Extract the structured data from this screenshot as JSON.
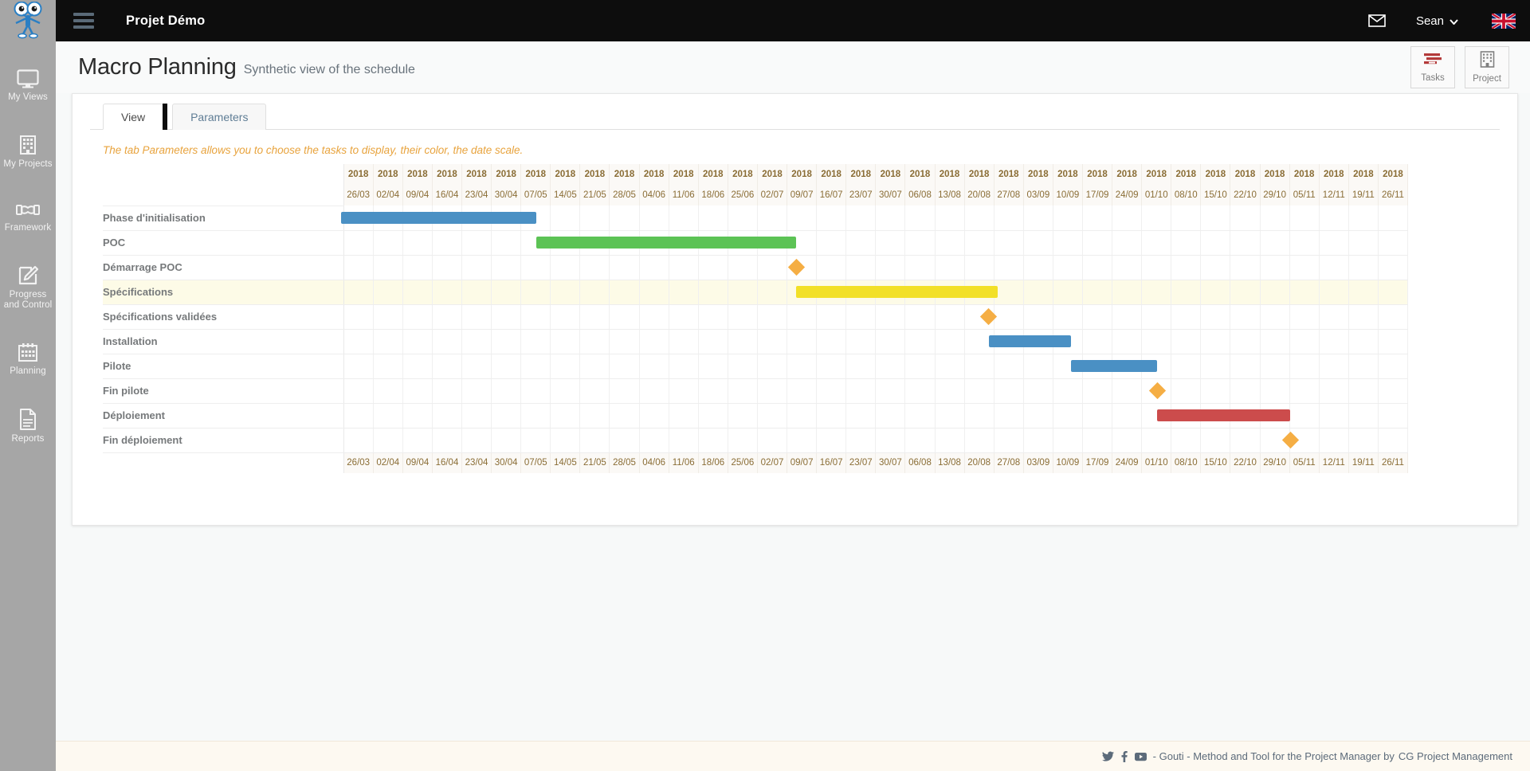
{
  "brand": {
    "logo_name": "gouti-mascot-logo"
  },
  "topbar": {
    "app_title": "Projet Démo",
    "menu_icon": "hamburger-menu-icon",
    "mail_icon": "envelope-icon",
    "user_name": "Sean",
    "chevron": "▾",
    "flag_icon": "uk-flag-icon"
  },
  "sidebar": {
    "items": [
      {
        "label": "My Views",
        "icon": "monitor-icon"
      },
      {
        "label": "My Projects",
        "icon": "building-icon"
      },
      {
        "label": "Framework",
        "icon": "handshake-icon"
      },
      {
        "label": "Progress and Control",
        "icon": "edit-pencil-icon"
      },
      {
        "label": "Planning",
        "icon": "calendar-icon"
      },
      {
        "label": "Reports",
        "icon": "document-icon"
      }
    ]
  },
  "page": {
    "title": "Macro Planning",
    "subtitle": "Synthetic view of the schedule",
    "buttons": [
      {
        "label": "Tasks",
        "icon": "gantt-bars-icon",
        "color": "#b33a3a"
      },
      {
        "label": "Project",
        "icon": "building-icon",
        "color": "#808080"
      }
    ]
  },
  "tabs": [
    {
      "label": "View",
      "active": true
    },
    {
      "label": "Parameters",
      "active": false
    }
  ],
  "hint": "The tab Parameters allows you to choose the tasks to display, their color, the date scale.",
  "colors": {
    "bar_blue": "#4a90c4",
    "bar_green": "#5cc355",
    "bar_yellow": "#f2e027",
    "bar_red": "#cc4c4c",
    "milestone_orange": "#f5ae44",
    "highlight_row": "#fdfbe7",
    "header_text": "#8a6d35"
  },
  "chart_data": {
    "type": "bar",
    "title": "Macro Planning",
    "xlabel": "",
    "ylabel": "",
    "year_label": "2018",
    "years": [
      "2018",
      "2018",
      "2018",
      "2018",
      "2018",
      "2018",
      "2018",
      "2018",
      "2018",
      "2018",
      "2018",
      "2018",
      "2018",
      "2018",
      "2018",
      "2018",
      "2018",
      "2018",
      "2018",
      "2018",
      "2018",
      "2018",
      "2018",
      "2018",
      "2018",
      "2018",
      "2018",
      "2018",
      "2018",
      "2018",
      "2018",
      "2018",
      "2018",
      "2018",
      "2018",
      "2018"
    ],
    "categories": [
      "26/03",
      "02/04",
      "09/04",
      "16/04",
      "23/04",
      "30/04",
      "07/05",
      "14/05",
      "21/05",
      "28/05",
      "04/06",
      "11/06",
      "18/06",
      "25/06",
      "02/07",
      "09/07",
      "16/07",
      "23/07",
      "30/07",
      "06/08",
      "13/08",
      "20/08",
      "27/08",
      "03/09",
      "10/09",
      "17/09",
      "24/09",
      "01/10",
      "08/10",
      "15/10",
      "22/10",
      "29/10",
      "05/11",
      "12/11",
      "19/11",
      "26/11"
    ],
    "tasks": [
      {
        "name": "Phase d'initialisation",
        "kind": "bar",
        "start_col": 1,
        "span": 6.6,
        "color": "#4a90c4",
        "highlight": false
      },
      {
        "name": "POC",
        "kind": "bar",
        "start_col": 7.6,
        "span": 8.8,
        "color": "#5cc355",
        "highlight": false
      },
      {
        "name": "Démarrage POC",
        "kind": "milestone",
        "start_col": 16.4,
        "span": 0,
        "color": "#f5ae44",
        "highlight": false
      },
      {
        "name": "Spécifications",
        "kind": "bar",
        "start_col": 16.4,
        "span": 6.8,
        "color": "#f2e027",
        "highlight": true
      },
      {
        "name": "Spécifications validées",
        "kind": "milestone",
        "start_col": 22.9,
        "span": 0,
        "color": "#f5ae44",
        "highlight": false
      },
      {
        "name": "Installation",
        "kind": "bar",
        "start_col": 22.9,
        "span": 2.8,
        "color": "#4a90c4",
        "highlight": false
      },
      {
        "name": "Pilote",
        "kind": "bar",
        "start_col": 25.7,
        "span": 2.9,
        "color": "#4a90c4",
        "highlight": false
      },
      {
        "name": "Fin pilote",
        "kind": "milestone",
        "start_col": 28.6,
        "span": 0,
        "color": "#f5ae44",
        "highlight": false
      },
      {
        "name": "Déploiement",
        "kind": "bar",
        "start_col": 28.6,
        "span": 4.5,
        "color": "#cc4c4c",
        "highlight": false
      },
      {
        "name": "Fin déploiement",
        "kind": "milestone",
        "start_col": 33.1,
        "span": 0,
        "color": "#f5ae44",
        "highlight": false
      }
    ]
  },
  "footer": {
    "social": [
      {
        "icon": "twitter-icon"
      },
      {
        "icon": "facebook-icon"
      },
      {
        "icon": "youtube-icon"
      }
    ],
    "text": "- Gouti - Method and Tool for the Project Manager by",
    "brand": "CG Project Management"
  }
}
